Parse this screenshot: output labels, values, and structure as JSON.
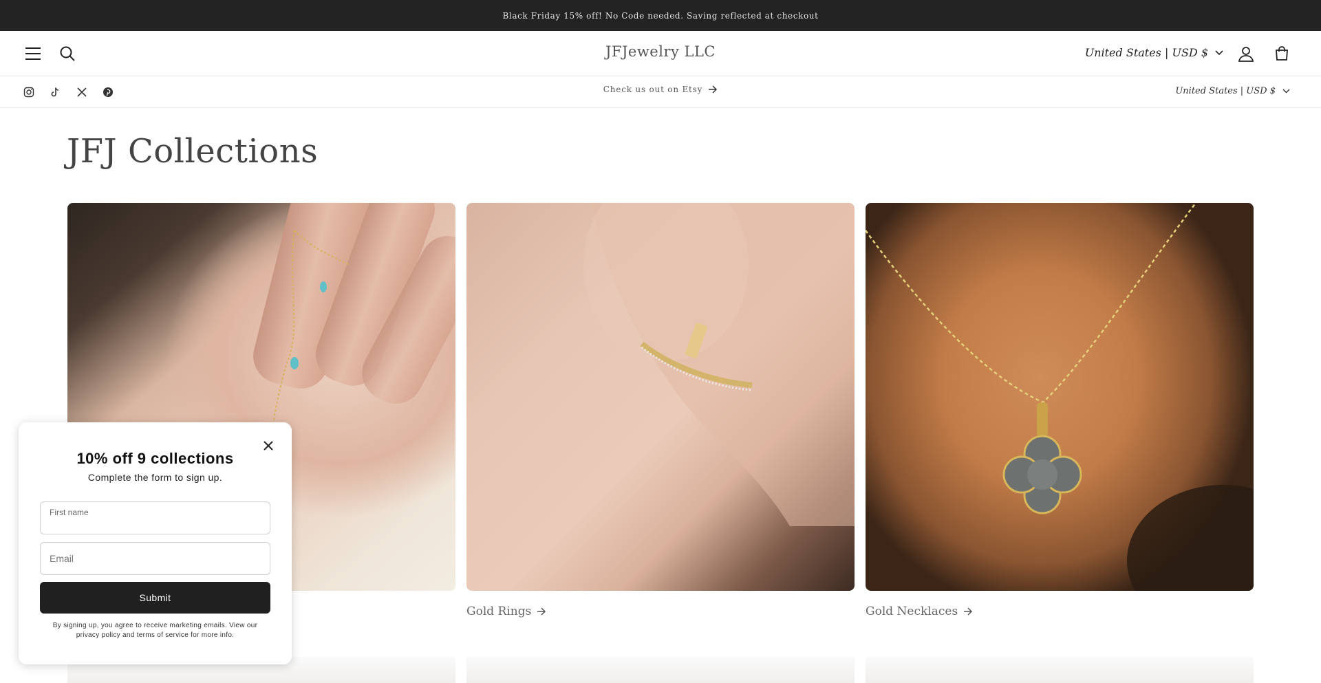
{
  "announcement": {
    "text": "Black Friday 15% off! No Code needed. Saving reflected at checkout"
  },
  "header": {
    "logo": "JFJewelry LLC",
    "country_selector": "United States | USD $",
    "icons": [
      "menu-icon",
      "search-icon",
      "account-icon",
      "cart-icon"
    ]
  },
  "subbar": {
    "social": [
      "instagram-icon",
      "tiktok-icon",
      "x-icon",
      "pinterest-icon"
    ],
    "etsy_link": "Check us out on Etsy",
    "country_selector": "United States | USD $"
  },
  "page": {
    "title": "JFJ Collections"
  },
  "collections": [
    {
      "label": ""
    },
    {
      "label": "Gold Rings"
    },
    {
      "label": "Gold Necklaces"
    }
  ],
  "popup": {
    "title": "10% off 9 collections",
    "subtitle": "Complete the form to sign up.",
    "first_name_label": "First name",
    "email_placeholder": "Email",
    "submit_label": "Submit",
    "legal": "By signing up, you agree to receive marketing emails. View our privacy policy and terms of service for more info."
  },
  "colors": {
    "announcement_bg": "#232323",
    "button_bg": "#202020",
    "text": "#333333"
  }
}
